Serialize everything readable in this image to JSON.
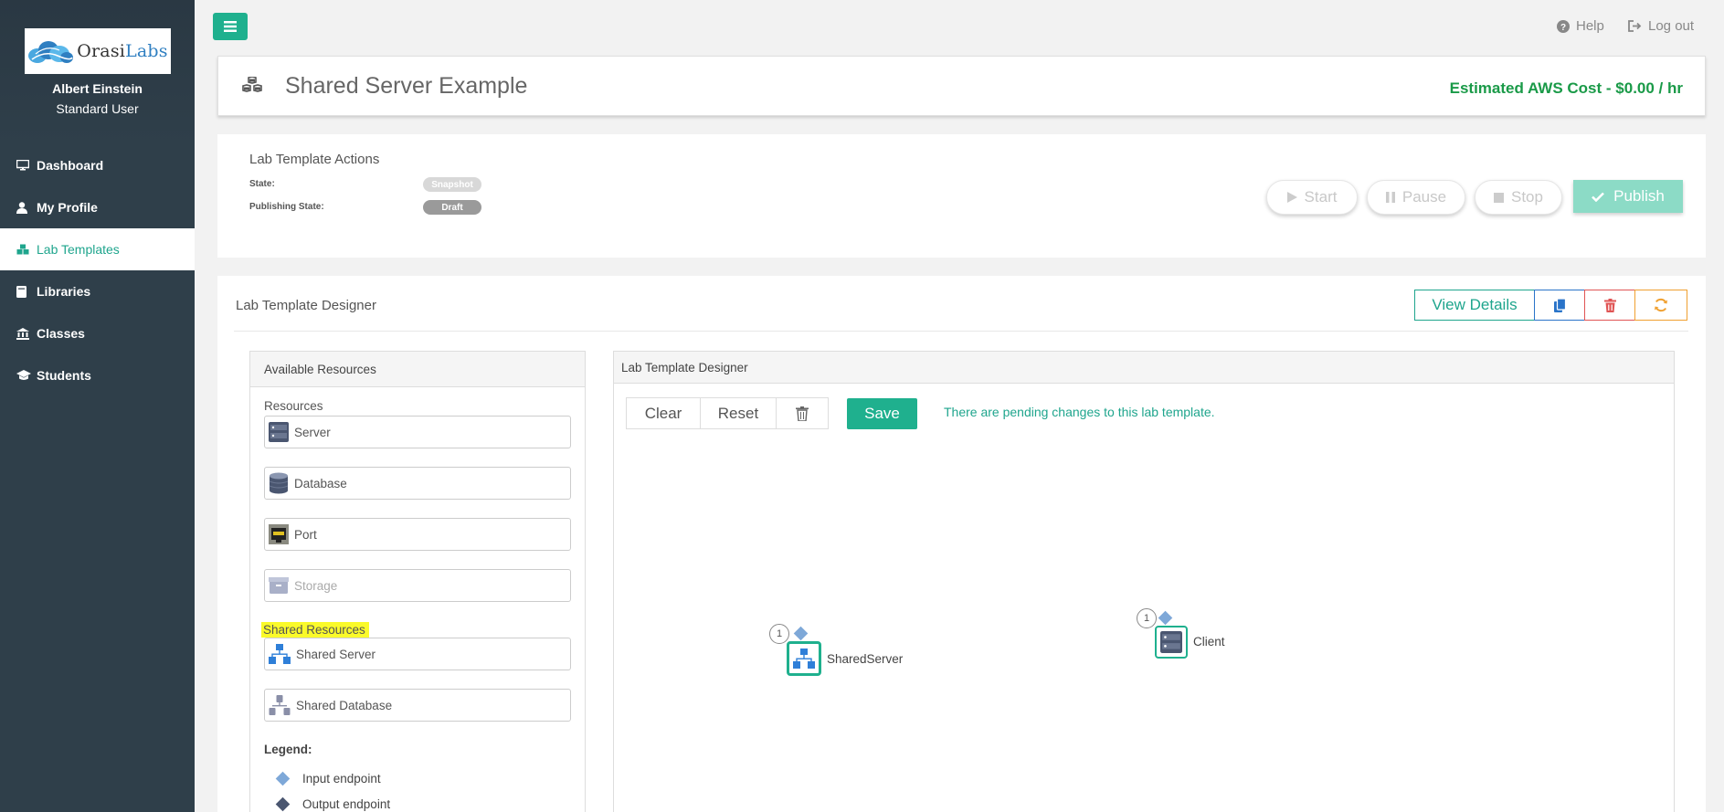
{
  "brand": {
    "logo_name": "Orasi",
    "logo_suffix": "Labs"
  },
  "user": {
    "name": "Albert Einstein",
    "role": "Standard User"
  },
  "sidebar": {
    "items": [
      {
        "label": "Dashboard",
        "icon": "monitor-icon"
      },
      {
        "label": "My Profile",
        "icon": "user-icon"
      },
      {
        "label": "Lab Templates",
        "icon": "cubes-icon",
        "active": true
      },
      {
        "label": "Libraries",
        "icon": "book-icon"
      },
      {
        "label": "Classes",
        "icon": "institution-icon"
      },
      {
        "label": "Students",
        "icon": "graduation-cap-icon"
      }
    ]
  },
  "topbar": {
    "help_label": "Help",
    "logout_label": "Log out"
  },
  "header": {
    "title": "Shared Server Example",
    "cost": "Estimated AWS Cost - $0.00 / hr"
  },
  "actions": {
    "title": "Lab Template Actions",
    "state_label": "State:",
    "state_value": "Snapshot",
    "publishing_label": "Publishing State:",
    "publishing_value": "Draft",
    "start_label": "Start",
    "pause_label": "Pause",
    "stop_label": "Stop",
    "publish_label": "Publish"
  },
  "designer": {
    "title": "Lab Template Designer",
    "view_details_label": "View Details",
    "panel_title": "Lab Template Designer",
    "clear_label": "Clear",
    "reset_label": "Reset",
    "save_label": "Save",
    "pending_message": "There are pending changes to this lab template.",
    "nodes": [
      {
        "label": "SharedServer",
        "count": "1"
      },
      {
        "label": "Client",
        "count": "1"
      }
    ]
  },
  "available": {
    "title": "Available Resources",
    "resources_label": "Resources",
    "resources": [
      {
        "label": "Server",
        "icon": "server-icon"
      },
      {
        "label": "Database",
        "icon": "database-icon"
      },
      {
        "label": "Port",
        "icon": "port-icon"
      },
      {
        "label": "Storage",
        "icon": "storage-icon",
        "disabled": true
      }
    ],
    "shared_label": "Shared Resources",
    "shared": [
      {
        "label": "Shared Server",
        "icon": "shared-server-icon"
      },
      {
        "label": "Shared Database",
        "icon": "shared-database-icon"
      }
    ],
    "legend_title": "Legend:",
    "legend": [
      {
        "label": "Input endpoint",
        "color": "#7ea8d8"
      },
      {
        "label": "Output endpoint",
        "color": "#4a5670"
      }
    ]
  },
  "colors": {
    "accent": "#1fb08e",
    "sidebar": "#2f3f4a",
    "cost": "#1a9a48",
    "delete": "#e05555",
    "refresh": "#f0a030",
    "copy": "#2a74c9"
  }
}
